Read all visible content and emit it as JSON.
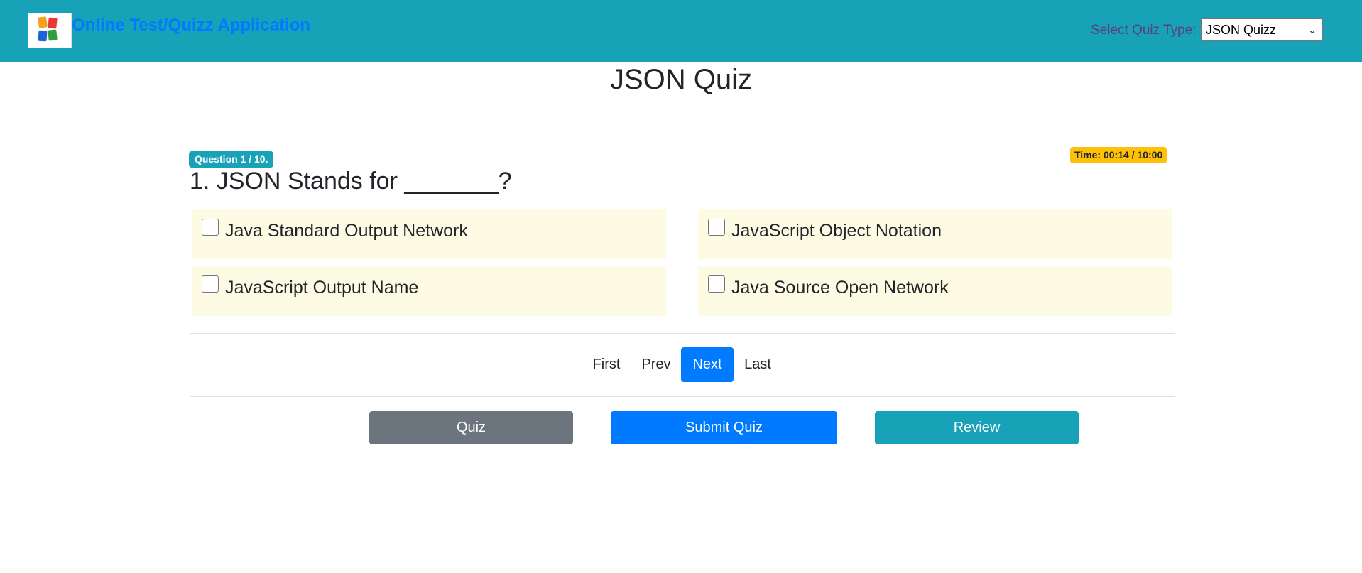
{
  "header": {
    "app_title": "Online Test/Quizz Application",
    "quiz_type_label": "Select Quiz Type:",
    "quiz_type_selected": "JSON Quizz",
    "brand_color": "#17a2b8",
    "logo_icon": "quiz-logo-icon"
  },
  "main": {
    "page_title": "JSON Quiz",
    "question_badge": "Question 1 / 10.",
    "timer_badge": "Time: 00:14 / 10:00",
    "question_text": "1. JSON Stands for _______?",
    "options": [
      {
        "label": "Java Standard Output Network",
        "checked": false
      },
      {
        "label": "JavaScript Object Notation",
        "checked": false
      },
      {
        "label": "JavaScript Output Name",
        "checked": false
      },
      {
        "label": "Java Source Open Network",
        "checked": false
      }
    ]
  },
  "pagination": {
    "first": "First",
    "prev": "Prev",
    "next": "Next",
    "last": "Last",
    "active": "Next"
  },
  "actions": {
    "quiz": "Quiz",
    "submit": "Submit Quiz",
    "review": "Review"
  },
  "colors": {
    "primary": "#007bff",
    "secondary": "#6c757d",
    "info": "#17a2b8",
    "warning": "#ffc107",
    "option_bg": "#fdfbe3"
  }
}
